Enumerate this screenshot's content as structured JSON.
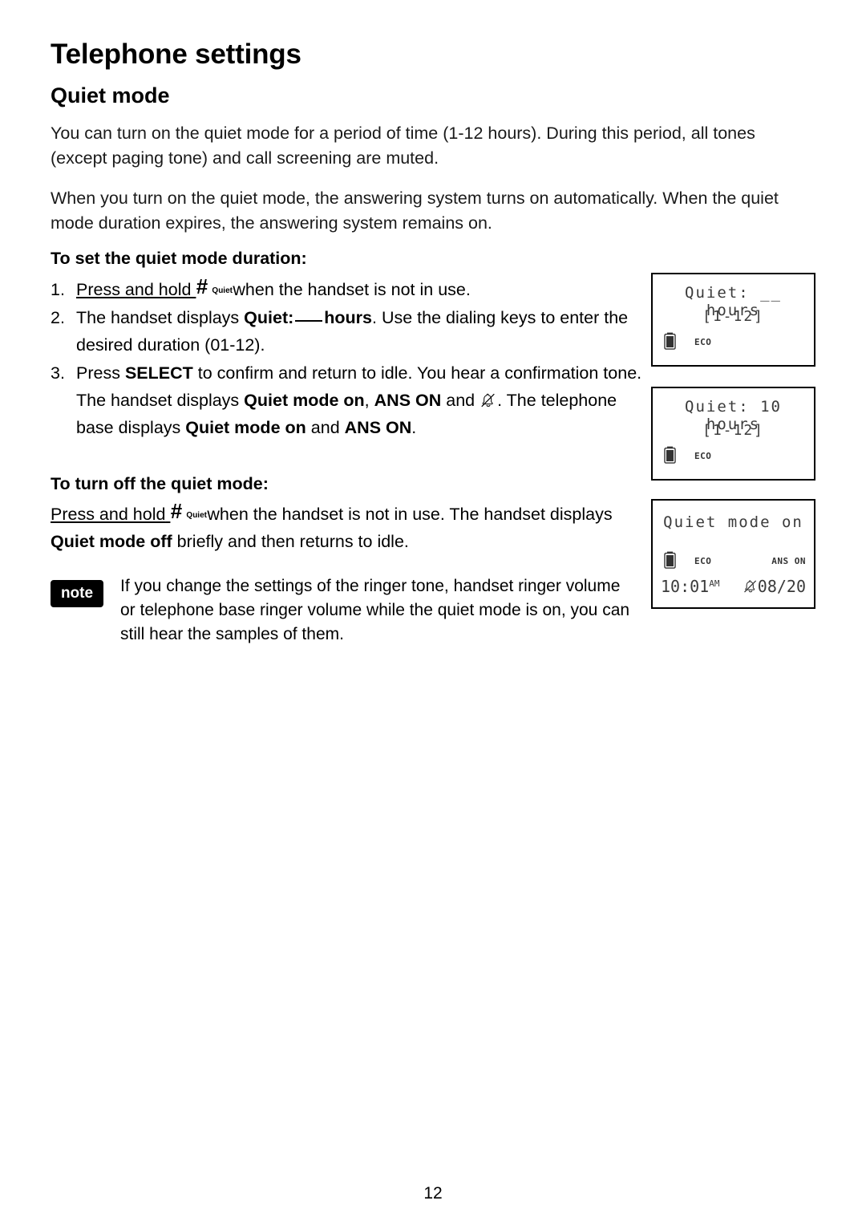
{
  "document": {
    "chapter_title": "Telephone settings",
    "section_title": "Quiet mode",
    "intro_paragraph_1": "You can turn on the quiet mode for a period of time (1-12 hours). During this period, all tones (except paging tone) and call screening are muted.",
    "intro_paragraph_2": "When you turn on the quiet mode, the answering system turns on automatically. When the quiet mode duration expires, the answering system remains on.",
    "subsection_set_duration": "To set the quiet mode duration:",
    "subsection_turn_off": "To turn off the quiet mode:",
    "page_number": "12"
  },
  "steps": [
    {
      "number": "1.",
      "prefix": "Press and hold",
      "key_icon": "hash-quiet-key-icon",
      "suffix": "when the handset is not in use."
    },
    {
      "number": "2.",
      "text_before": "The handset displays",
      "bold_1": "Quiet:",
      "bold_2": "hours",
      "text_after": ". Use the dialing keys to enter the desired duration (01-12)."
    },
    {
      "number": "3.",
      "text_1": "Press",
      "bold_select": "SELECT",
      "text_2": "to confirm and return to idle. You hear a confirmation tone. The handset displays",
      "bold_quiet_on": "Quiet mode on",
      "text_3": ",",
      "bold_ans_on": "ANS ON",
      "text_4": "and",
      "icon": "bell-mute-icon",
      "text_5": ". The telephone base displays",
      "bold_quiet_mode": "Quiet mode",
      "bold_on": "on",
      "text_6": "and",
      "bold_ans_on_2": "ANS ON",
      "text_7": "."
    }
  ],
  "turn_off": {
    "prefix": "Press and hold",
    "key_icon": "hash-quiet-key-icon",
    "middle": "when the handset is not in use. The handset displays",
    "bold": "Quiet mode off",
    "suffix": "briefly and then returns to idle."
  },
  "note": {
    "badge_label": "note",
    "text": "If you change the settings of the ringer tone, handset ringer volume or telephone base ringer volume while the quiet mode is on, you can still hear the samples of them."
  },
  "screens": [
    {
      "name": "quiet-duration-empty",
      "line1": "Quiet: __ hours",
      "line2": "[1-12]",
      "battery_icon": "battery-icon",
      "eco_label": "ECO"
    },
    {
      "name": "quiet-duration-10",
      "line1": "Quiet: 10 hours",
      "line2": "[1-12]",
      "battery_icon": "battery-icon",
      "eco_label": "ECO"
    },
    {
      "name": "quiet-mode-on-idle",
      "line1": "Quiet mode on",
      "battery_icon": "battery-icon",
      "eco_label": "ECO",
      "ans_on_label": "ANS ON",
      "time": "10:01",
      "time_meridiem": "AM",
      "bell_icon": "bell-mute-icon",
      "date": "08/20"
    }
  ]
}
